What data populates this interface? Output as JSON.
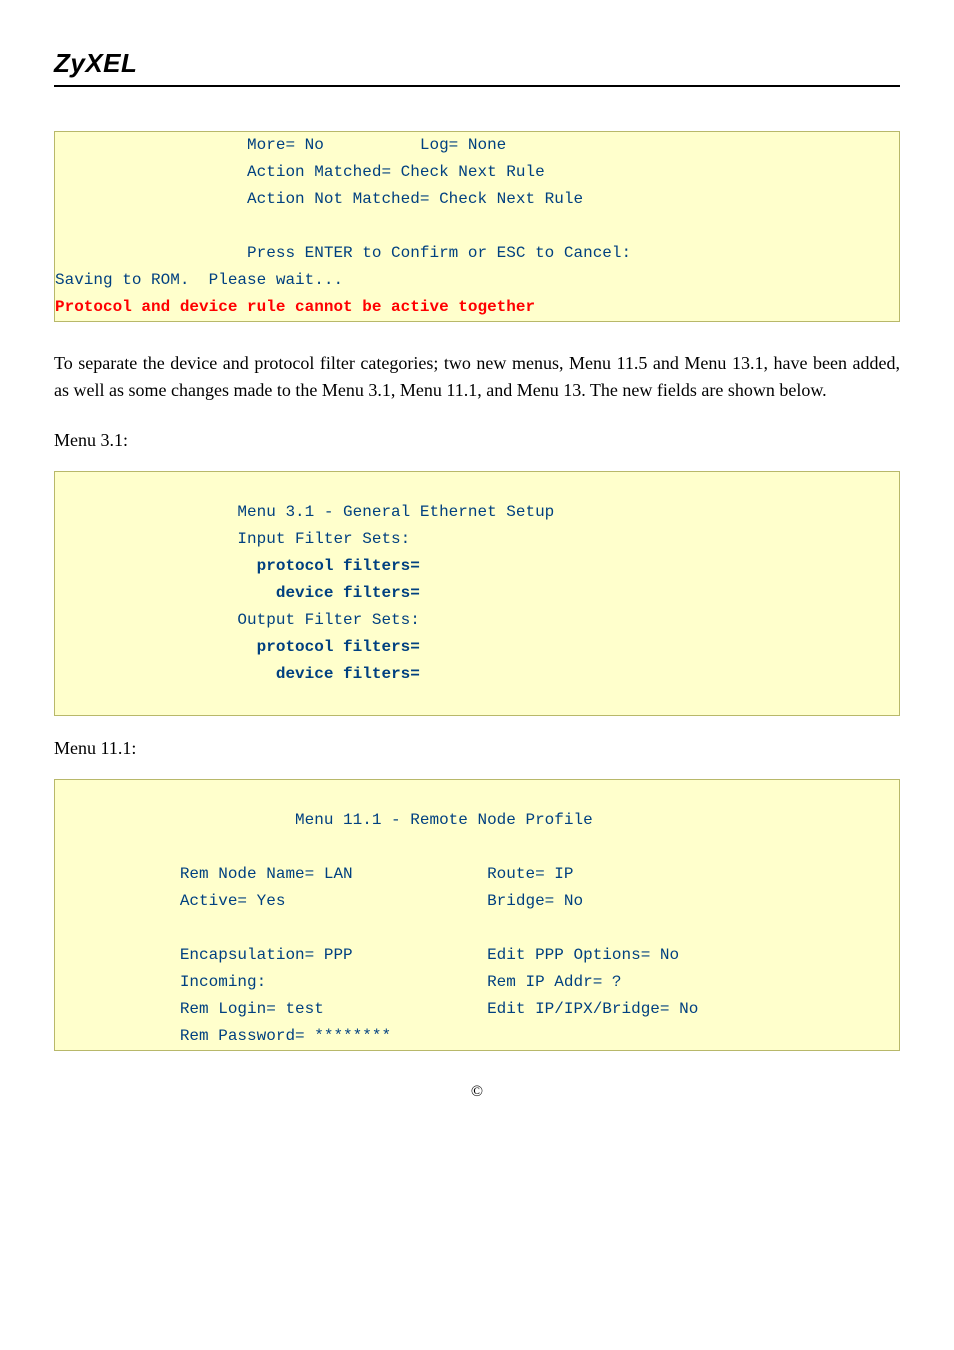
{
  "header": {
    "logo": "ZyXEL"
  },
  "term1": {
    "l1": "                    More= No          Log= None",
    "l2": "                    Action Matched= Check Next Rule",
    "l3": "                    Action Not Matched= Check Next Rule",
    "l4": "",
    "l5": "                    Press ENTER to Confirm or ESC to Cancel:",
    "l6": "Saving to ROM.  Please wait...",
    "err": "Protocol and device rule cannot be active together"
  },
  "para1": "To separate the device and protocol filter categories; two new menus, Menu 11.5 and Menu 13.1, have been added, as well as some changes made to the Menu 3.1, Menu 11.1, and Menu 13. The new fields are shown below.",
  "label_menu31": "Menu 3.1:",
  "term2": {
    "l0": "",
    "l1": "                   Menu 3.1 - General Ethernet Setup",
    "l2": "                   Input Filter Sets:",
    "l3a": "                     ",
    "l3b": "protocol filters=",
    "l4a": "                       ",
    "l4b": "device filters=",
    "l5": "                   Output Filter Sets:",
    "l6a": "                     ",
    "l6b": "protocol filters=",
    "l7a": "                       ",
    "l7b": "device filters=",
    "l8": "",
    "l9": ""
  },
  "label_menu111": "Menu 11.1:",
  "term3": {
    "l0": "",
    "l1": "                         Menu 11.1 - Remote Node Profile",
    "l2": "",
    "l3": "             Rem Node Name= LAN              Route= IP",
    "l4": "             Active= Yes                     Bridge= No",
    "l5": "",
    "l6": "             Encapsulation= PPP              Edit PPP Options= No",
    "l7": "             Incoming:                       Rem IP Addr= ?",
    "l8": "             Rem Login= test                 Edit IP/IPX/Bridge= No",
    "l9": "             Rem Password= ********"
  },
  "copyright": "©"
}
